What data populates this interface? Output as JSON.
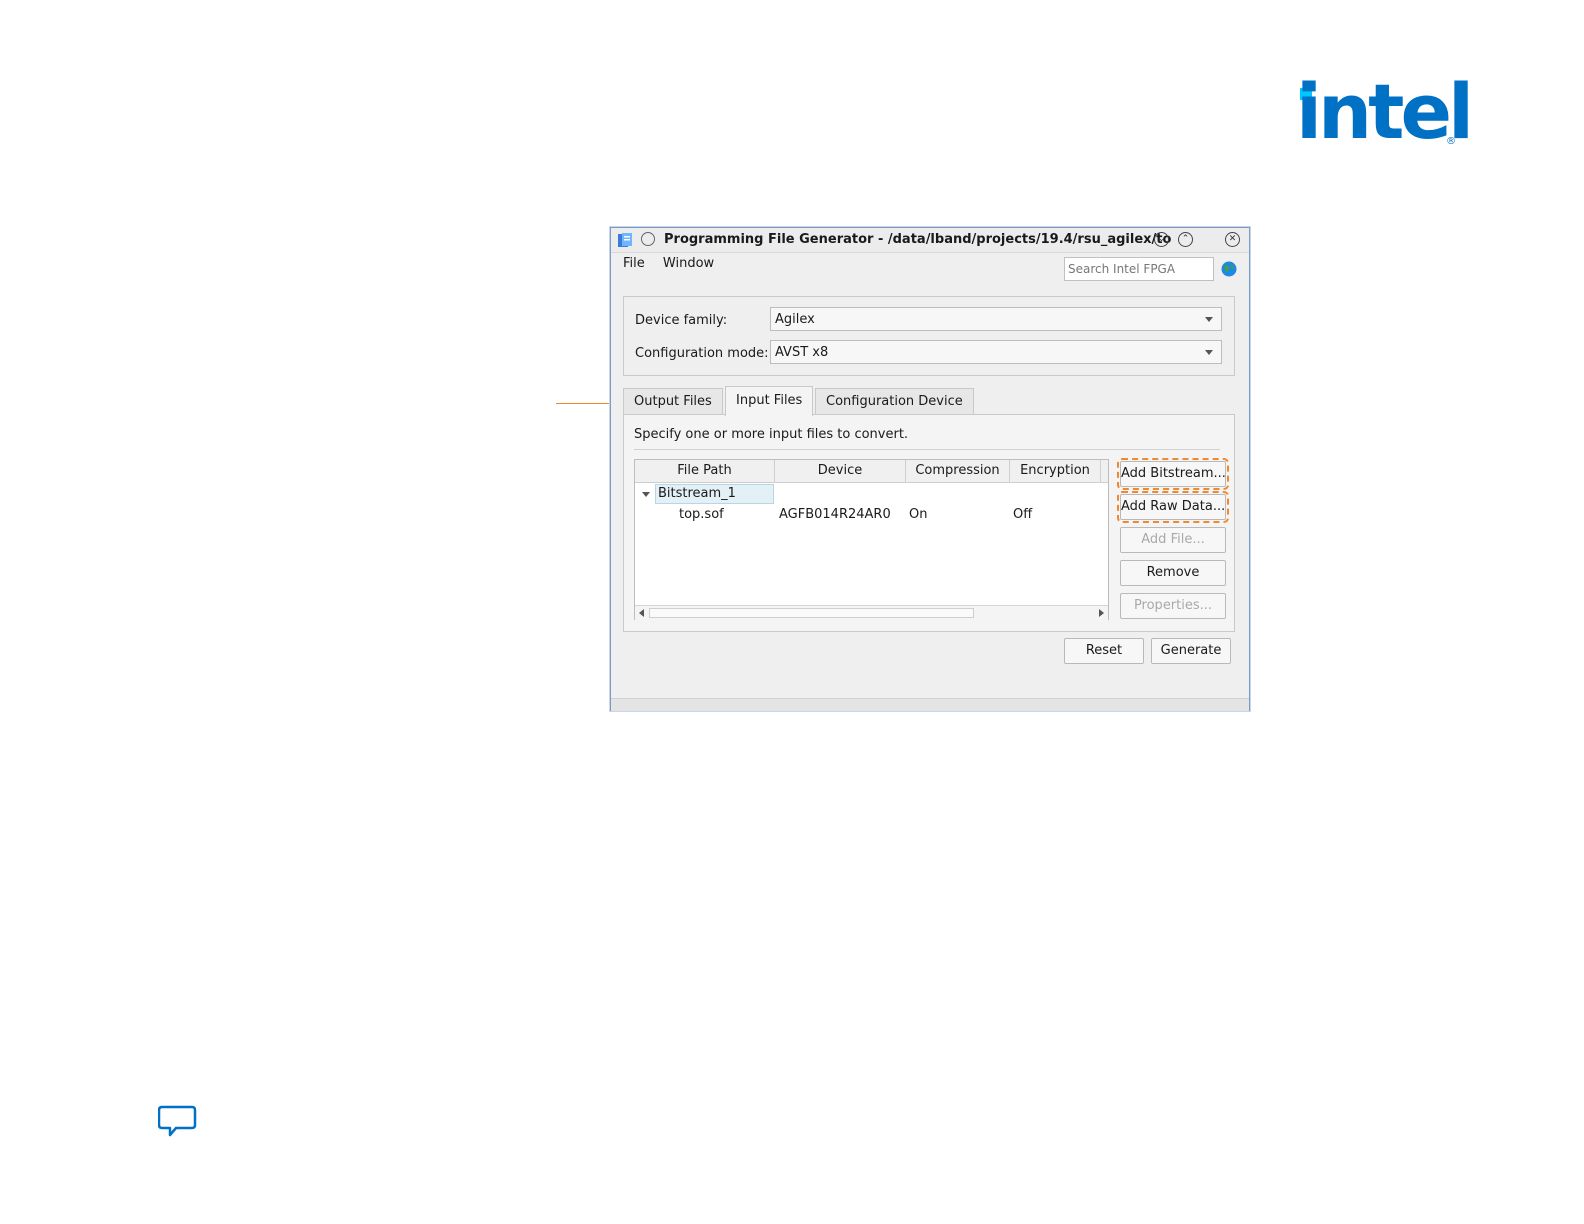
{
  "brand": {
    "logo_text": "intel",
    "registered_mark": "®",
    "accent": "#0071c5",
    "dot_color": "#00c7fd"
  },
  "callout": {
    "color": "#f0892e"
  },
  "window": {
    "title": "Programming File Generator - /data/lband/projects/19.4/rsu_agilex/to",
    "menu": {
      "file": "File",
      "window": "Window"
    },
    "search": {
      "placeholder": "Search Intel FPGA"
    },
    "device": {
      "family_label": "Device family:",
      "family_value": "Agilex",
      "mode_label": "Configuration mode:",
      "mode_value": "AVST x8"
    },
    "tabs": [
      {
        "label": "Output Files"
      },
      {
        "label": "Input Files",
        "active": true
      },
      {
        "label": "Configuration Device"
      }
    ],
    "input_panel": {
      "instruction": "Specify one or more input files to convert.",
      "columns": [
        "File Path",
        "Device",
        "Compression",
        "Encryption"
      ],
      "tree": {
        "group": "Bitstream_1",
        "rows": [
          {
            "file": "top.sof",
            "device": "AGFB014R24AR0",
            "compression": "On",
            "encryption": "Off"
          }
        ]
      },
      "buttons": {
        "add_bitstream": "Add Bitstream...",
        "add_raw_data": "Add Raw Data...",
        "add_file": "Add File...",
        "remove": "Remove",
        "properties": "Properties..."
      }
    },
    "footer": {
      "reset": "Reset",
      "generate": "Generate"
    }
  }
}
